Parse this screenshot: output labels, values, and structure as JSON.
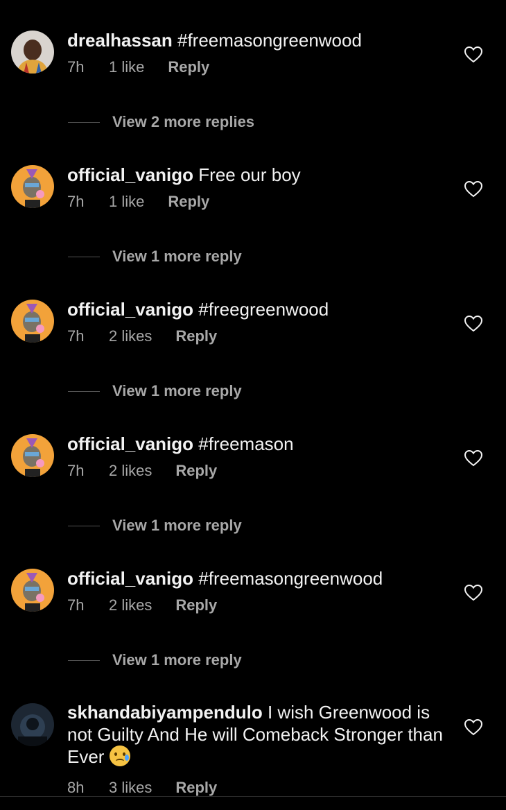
{
  "comments": [
    {
      "username": "drealhassan",
      "text": "#freemasongreenwood",
      "time": "7h",
      "likes": "1 like",
      "reply": "Reply",
      "view_more": "View 2 more replies",
      "avatar": "person-photo"
    },
    {
      "username": "official_vanigo",
      "text": "Free our boy",
      "time": "7h",
      "likes": "1 like",
      "reply": "Reply",
      "view_more": "View 1 more reply",
      "avatar": "ape-nft"
    },
    {
      "username": "official_vanigo",
      "text": "#freegreenwood",
      "time": "7h",
      "likes": "2 likes",
      "reply": "Reply",
      "view_more": "View 1 more reply",
      "avatar": "ape-nft"
    },
    {
      "username": "official_vanigo",
      "text": "#freemason",
      "time": "7h",
      "likes": "2 likes",
      "reply": "Reply",
      "view_more": "View 1 more reply",
      "avatar": "ape-nft"
    },
    {
      "username": "official_vanigo",
      "text": "#freemasongreenwood",
      "time": "7h",
      "likes": "2 likes",
      "reply": "Reply",
      "view_more": "View 1 more reply",
      "avatar": "ape-nft"
    },
    {
      "username": "skhandabiyampendulo",
      "text": "I wish Greenwood is not Guilty And He will Comeback Stronger than Ever",
      "emoji": "crying-face",
      "time": "8h",
      "likes": "3 likes",
      "reply": "Reply",
      "avatar": "dark-photo"
    }
  ],
  "colors": {
    "background": "#000000",
    "primary_text": "#f2f2f2",
    "secondary_text": "#a8a8a8",
    "avatar_ape_bg": "#f2a23a"
  },
  "icons": {
    "like": "heart-outline-icon"
  }
}
